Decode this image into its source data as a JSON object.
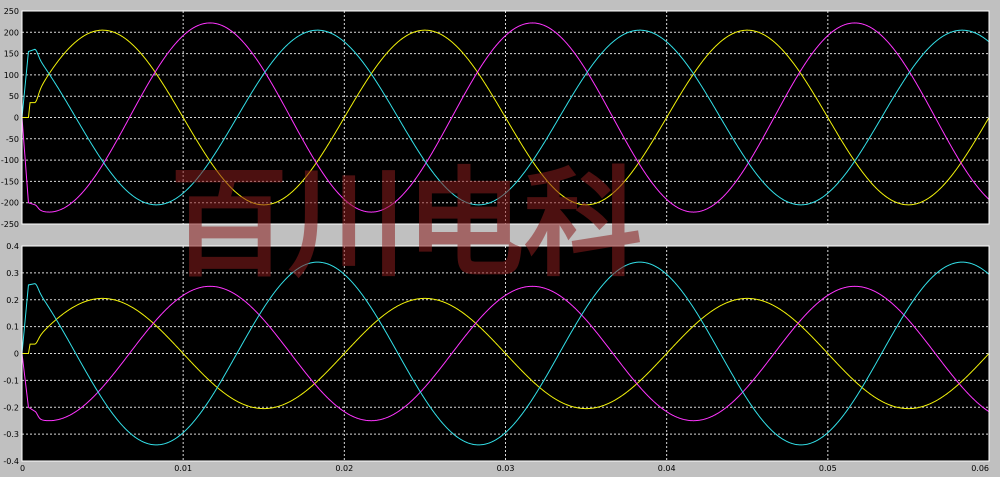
{
  "chart_data": [
    {
      "type": "line",
      "title": "",
      "xlabel": "",
      "ylabel": "",
      "xlim": [
        0,
        0.06
      ],
      "ylim": [
        -250,
        250
      ],
      "x_ticks": [
        "0",
        "0.01",
        "0.02",
        "0.03",
        "0.04",
        "0.05",
        "0.06"
      ],
      "y_ticks": [
        "250",
        "200",
        "150",
        "100",
        "50",
        "0",
        "-50",
        "-100",
        "-150",
        "-200",
        "-250"
      ],
      "grid": true,
      "colors": {
        "background": "#000000",
        "grid": "#ffffff"
      },
      "series": [
        {
          "color": "#f2f20a",
          "amplitude": 205,
          "frequency_hz": 50,
          "phase_deg": 0,
          "startup": [
            [
              0,
              0
            ],
            [
              0.0004,
              0
            ],
            [
              0.0005,
              35
            ],
            [
              0.0008,
              35
            ]
          ]
        },
        {
          "color": "#ff35ff",
          "amplitude": 222,
          "frequency_hz": 50,
          "phase_deg": -120,
          "startup": [
            [
              0,
              0
            ],
            [
              0.0004,
              -200
            ],
            [
              0.0008,
              -205
            ]
          ]
        },
        {
          "color": "#33e0e8",
          "amplitude": 205,
          "frequency_hz": 50,
          "phase_deg": 120,
          "startup": [
            [
              0,
              0
            ],
            [
              0.0004,
              155
            ],
            [
              0.0008,
              160
            ]
          ]
        }
      ]
    },
    {
      "type": "line",
      "title": "",
      "xlabel": "",
      "ylabel": "",
      "xlim": [
        0,
        0.06
      ],
      "ylim": [
        -0.4,
        0.4
      ],
      "x_ticks": [
        "0",
        "0.01",
        "0.02",
        "0.03",
        "0.04",
        "0.05",
        "0.06"
      ],
      "y_ticks": [
        "0.4",
        "0.3",
        "0.2",
        "0.1",
        "0",
        "-0.1",
        "-0.2",
        "-0.3",
        "-0.4"
      ],
      "grid": true,
      "colors": {
        "background": "#000000",
        "grid": "#ffffff"
      },
      "series": [
        {
          "color": "#f2f20a",
          "amplitude": 0.205,
          "frequency_hz": 50,
          "phase_deg": 0,
          "startup": [
            [
              0,
              0
            ],
            [
              0.0004,
              0
            ],
            [
              0.0005,
              0.035
            ],
            [
              0.0008,
              0.035
            ]
          ]
        },
        {
          "color": "#ff35ff",
          "amplitude": 0.25,
          "frequency_hz": 50,
          "phase_deg": -120,
          "startup": [
            [
              0,
              0
            ],
            [
              0.0004,
              -0.2
            ],
            [
              0.0008,
              -0.215
            ]
          ]
        },
        {
          "color": "#33e0e8",
          "amplitude": 0.34,
          "frequency_hz": 50,
          "phase_deg": 120,
          "startup": [
            [
              0,
              0
            ],
            [
              0.0004,
              0.255
            ],
            [
              0.0008,
              0.26
            ]
          ]
        }
      ]
    }
  ],
  "watermark": {
    "text": "百川电科",
    "color": "#8b1e1e"
  }
}
